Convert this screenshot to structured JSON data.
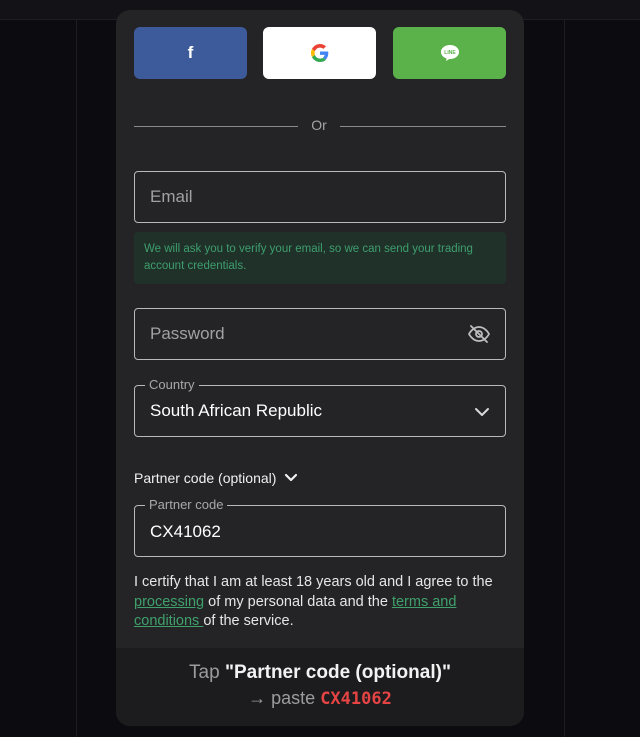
{
  "social": {
    "facebook_glyph": "f",
    "google_icon": "google-icon",
    "line_text": "LINE",
    "colors": {
      "facebook": "#3d5a9a",
      "google": "#ffffff",
      "line": "#5bb24a"
    }
  },
  "divider": {
    "label": "Or"
  },
  "email": {
    "placeholder": "Email",
    "value": ""
  },
  "notice": {
    "text": "We will ask you to verify your email, so we can send your trading account credentials."
  },
  "password": {
    "placeholder": "Password",
    "value": "",
    "toggle_icon": "eye-slash-icon"
  },
  "country": {
    "label": "Country",
    "value": "South African Republic"
  },
  "partner": {
    "toggle_label": "Partner code (optional)",
    "label": "Partner code",
    "value": "CX41062"
  },
  "terms": {
    "prefix": "I certify that I am at least 18 years old and I agree to the ",
    "link1": "processing",
    "middle": " of my personal data and the ",
    "link2": "terms and conditions ",
    "suffix": "of the service."
  },
  "hint": {
    "tap": "Tap ",
    "target": "\"Partner code (optional)\"",
    "arrow": "→ paste ",
    "code": "CX41062"
  },
  "accent": {
    "green": "#3fa06b",
    "red": "#e64444"
  }
}
